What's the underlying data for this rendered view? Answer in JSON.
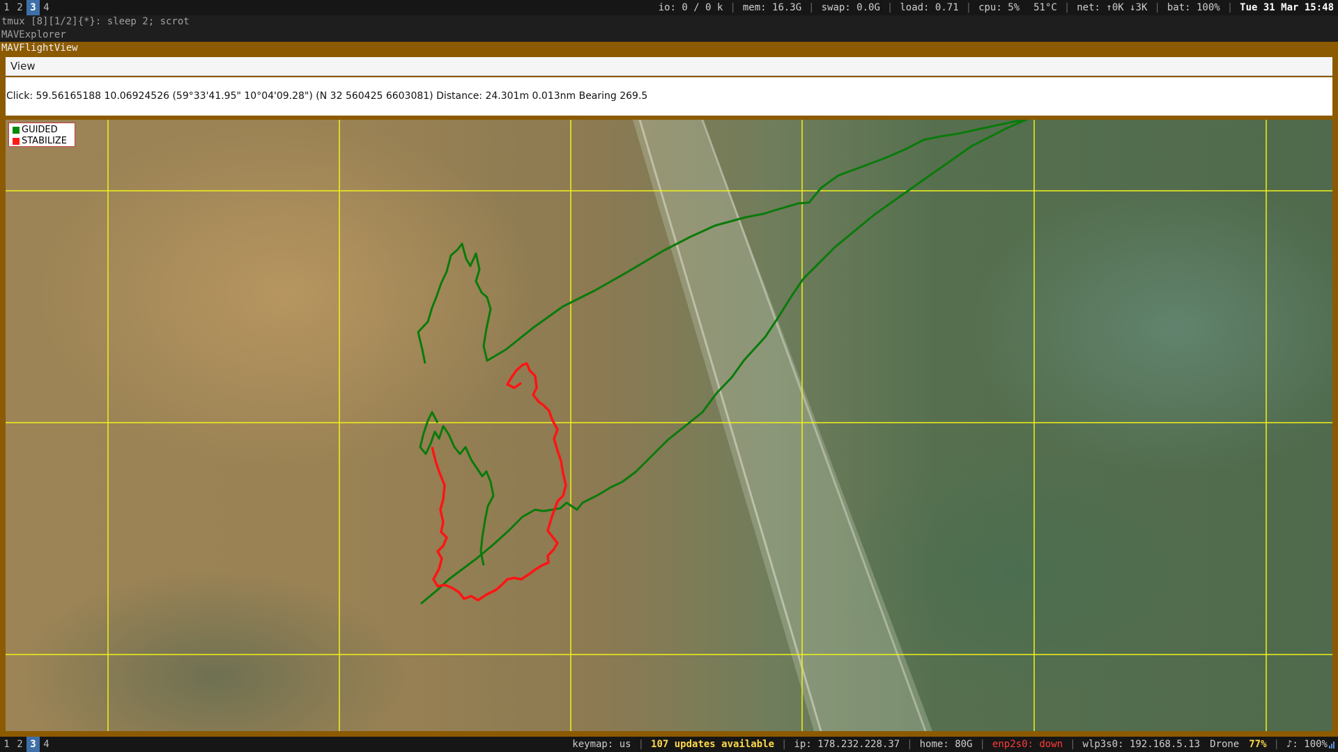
{
  "topbar": {
    "workspaces": [
      "1",
      "2",
      "3",
      "4"
    ],
    "active_workspace": "3",
    "io": "io: 0    /    0 k",
    "mem": "mem: 16.3G",
    "swap": "swap: 0.0G",
    "load": "load: 0.71",
    "cpu": "cpu:   5%",
    "temp": "51°C",
    "net": "net:    ↑0K   ↓3K",
    "bat": "bat: 100%",
    "datetime": "Tue 31 Mar 15:48"
  },
  "tmux_line": "tmux [8][1/2]{*}:  sleep 2; scrot",
  "app_title": "MAVExplorer",
  "window": {
    "title": "MAVFlightView",
    "menu_view": "View",
    "info": "Click: 59.56165188 10.06924526 (59°33'41.95\" 10°04'09.28\") (N 32 560425 6603081)  Distance: 24.301m 0.013nm Bearing 269.5"
  },
  "legend": [
    {
      "label": "GUIDED",
      "color": "#0a8a0a"
    },
    {
      "label": "STABILIZE",
      "color": "#ff1a1a"
    }
  ],
  "colors": {
    "grid": "#f2f21a",
    "guided_track": "#0a7a0a",
    "stabilize_track": "#ff1414"
  },
  "bottombar": {
    "workspaces": [
      "1",
      "2",
      "3",
      "4"
    ],
    "active_workspace": "3",
    "keymap": "keymap: us",
    "updates": "107 updates available",
    "ip": "ip: 178.232.228.37",
    "home": "home: 80G",
    "enp": "enp2s0: down",
    "wlp": "wlp3s0: 192.168.5.13",
    "wifi_name": "Drone",
    "wifi_strength": "77%",
    "volume": "♪: 100%"
  }
}
